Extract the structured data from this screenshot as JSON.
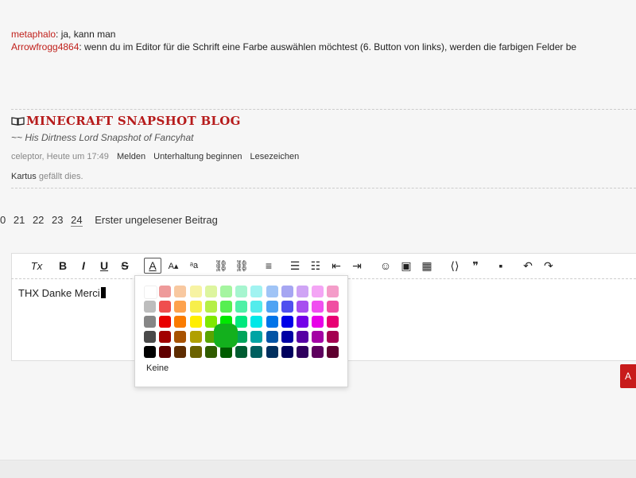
{
  "chat": [
    {
      "user": "metaphalo",
      "text": ": ja, kann man"
    },
    {
      "user": "Arrowfrogg4864",
      "text": ": wenn du im Editor für die Schrift eine Farbe auswählen möchtest (6. Button von links), werden die farbigen Felder be"
    }
  ],
  "signature": {
    "title": "MINECRAFT SNAPSHOT BLOG",
    "subtitle": "~~ His Dirtness Lord Snapshot of Fancyhat"
  },
  "post_meta": {
    "author_time": "celeptor, Heute um 17:49",
    "report": "Melden",
    "start_conversation": "Unterhaltung beginnen",
    "bookmark": "Lesezeichen"
  },
  "likes": {
    "user": "Kartus",
    "text": " gefällt dies."
  },
  "pager": {
    "pages": [
      "0",
      "21",
      "22",
      "23",
      "24"
    ],
    "current": "24",
    "first_unread": "Erster ungelesener Beitrag"
  },
  "editor": {
    "content": "THX Danke Merci",
    "toolbar": [
      {
        "icon": "remove-format-icon",
        "glyph": "Tx"
      },
      {
        "icon": "bold-icon",
        "glyph": "B"
      },
      {
        "icon": "italic-icon",
        "glyph": "I"
      },
      {
        "icon": "underline-icon",
        "glyph": "U"
      },
      {
        "icon": "strikethrough-icon",
        "glyph": "S"
      },
      {
        "icon": "font-color-icon",
        "glyph": "A"
      },
      {
        "icon": "font-size-icon",
        "glyph": "A▴"
      },
      {
        "icon": "font-family-icon",
        "glyph": "ᵃa"
      },
      {
        "icon": "link-icon",
        "glyph": "⛓"
      },
      {
        "icon": "unlink-icon",
        "glyph": "⛓"
      },
      {
        "icon": "align-icon",
        "glyph": "≡"
      },
      {
        "icon": "bullet-list-icon",
        "glyph": "☰"
      },
      {
        "icon": "numbered-list-icon",
        "glyph": "☷"
      },
      {
        "icon": "outdent-icon",
        "glyph": "⇤"
      },
      {
        "icon": "indent-icon",
        "glyph": "⇥"
      },
      {
        "icon": "smiley-icon",
        "glyph": "☺"
      },
      {
        "icon": "image-icon",
        "glyph": "▣"
      },
      {
        "icon": "media-icon",
        "glyph": "▦"
      },
      {
        "icon": "code-icon",
        "glyph": "⟨⟩"
      },
      {
        "icon": "quote-icon",
        "glyph": "❞"
      },
      {
        "icon": "save-icon",
        "glyph": "▪"
      },
      {
        "icon": "undo-icon",
        "glyph": "↶"
      },
      {
        "icon": "redo-icon",
        "glyph": "↷"
      }
    ]
  },
  "color_picker": {
    "none_label": "Keine",
    "rows": [
      [
        "#ffffff",
        "#ee9a9a",
        "#f8c8a0",
        "#f7f3a3",
        "#ddf59f",
        "#a5f5a0",
        "#a6f5cf",
        "#a1f3f1",
        "#a0c4f6",
        "#a6a6f2",
        "#cfa4f5",
        "#f4a5f5",
        "#f49dc9"
      ],
      [
        "#bdbdbd",
        "#ef4e4e",
        "#fda24d",
        "#f7ef4c",
        "#b5ef47",
        "#56ef51",
        "#4ff0a6",
        "#53ecec",
        "#4fa3f3",
        "#5050ef",
        "#a74ff0",
        "#f04ff0",
        "#f04fa2"
      ],
      [
        "#868686",
        "#e80000",
        "#fa7b00",
        "#ffee00",
        "#7fe800",
        "#00e800",
        "#00e87e",
        "#00e8e8",
        "#0073e8",
        "#0000e8",
        "#7300e8",
        "#e800e8",
        "#e80073"
      ],
      [
        "#4a4a4a",
        "#a10000",
        "#a75200",
        "#b0a000",
        "#59a400",
        "#00a400",
        "#00a45a",
        "#00a4a4",
        "#0053a4",
        "#0000a4",
        "#5600a4",
        "#a400a4",
        "#a40050"
      ],
      [
        "#000000",
        "#610000",
        "#5e2c00",
        "#6b6200",
        "#305c00",
        "#005c00",
        "#005c31",
        "#006060",
        "#002f5e",
        "#00005e",
        "#2f005e",
        "#5e005e",
        "#5e002f"
      ]
    ]
  },
  "send_button": {
    "label": "A"
  }
}
